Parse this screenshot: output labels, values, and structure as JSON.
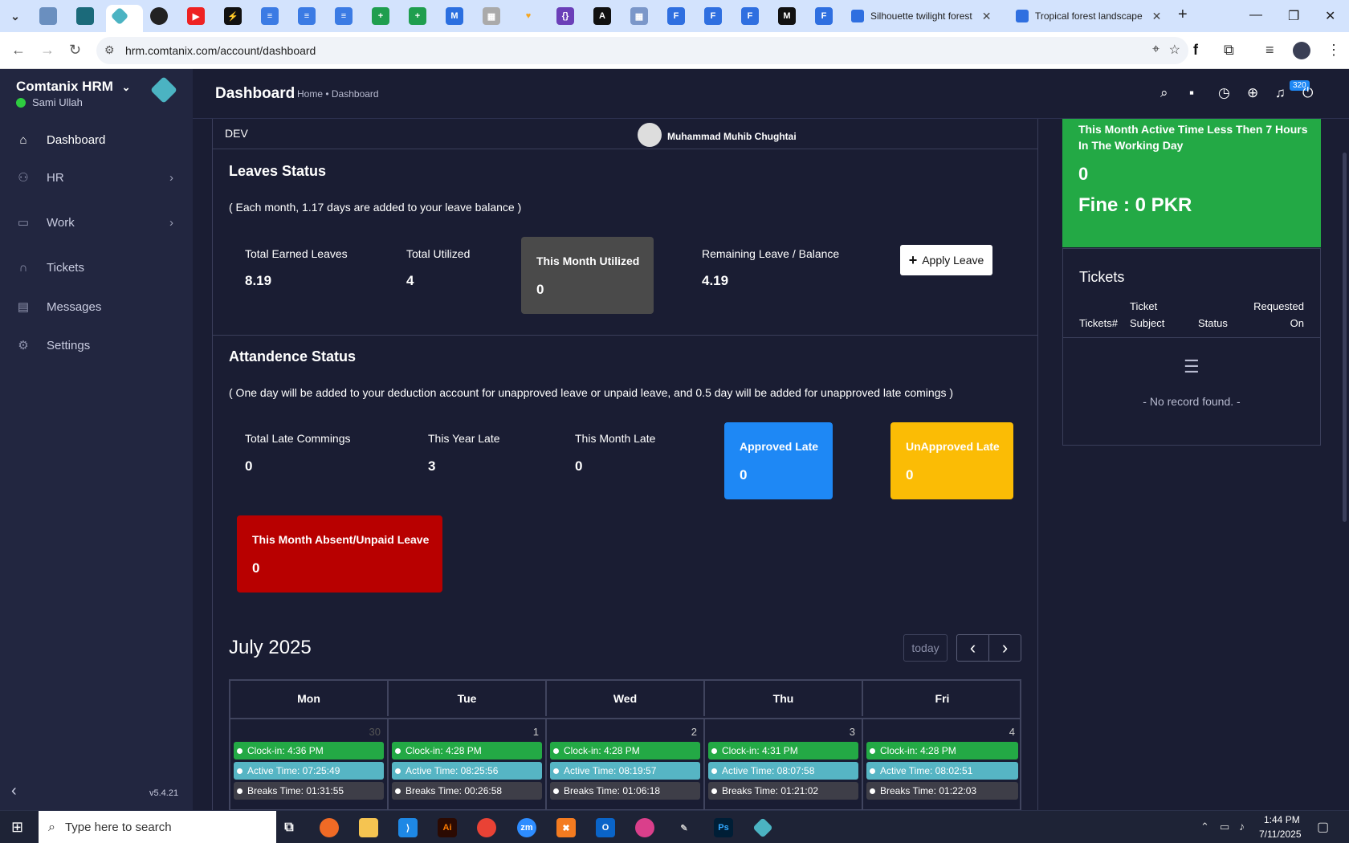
{
  "browser": {
    "tabs": [
      {
        "title": "Silhouette twilight forest",
        "close": "✕"
      },
      {
        "title": "Tropical forest landscape",
        "close": "✕"
      }
    ],
    "new_tab": "+",
    "url": "hrm.comtanix.com/account/dashboard"
  },
  "sidebar": {
    "brand": "Comtanix HRM",
    "user": "Sami Ullah",
    "version": "v5.4.21",
    "items": [
      {
        "label": "Dashboard",
        "icon": "home-icon"
      },
      {
        "label": "HR",
        "icon": "users-icon"
      },
      {
        "label": "Work",
        "icon": "briefcase-icon"
      },
      {
        "label": "Tickets",
        "icon": "headset-icon"
      },
      {
        "label": "Messages",
        "icon": "message-icon"
      },
      {
        "label": "Settings",
        "icon": "gear-icon"
      }
    ]
  },
  "header": {
    "title": "Dashboard",
    "breadcrumb": "Home • Dashboard",
    "notification_count": "320"
  },
  "profile_strip": {
    "dept": "DEV",
    "name": "Muhammad Muhib Chughtai"
  },
  "leaves": {
    "title": "Leaves Status",
    "note": "( Each month, 1.17 days are added to your leave balance )",
    "earned_label": "Total Earned Leaves",
    "earned_value": "8.19",
    "utilized_label": "Total Utilized",
    "utilized_value": "4",
    "month_label": "This Month Utilized",
    "month_value": "0",
    "remaining_label": "Remaining Leave / Balance",
    "remaining_value": "4.19",
    "apply_label": "Apply Leave"
  },
  "attendance": {
    "title": "Attandence Status",
    "note": "( One day will be added to your deduction account for unapproved leave or unpaid leave, and 0.5 day will be added for unapproved late comings )",
    "total_late_label": "Total Late Commings",
    "total_late_value": "0",
    "year_late_label": "This Year Late",
    "year_late_value": "3",
    "month_late_label": "This Month Late",
    "month_late_value": "0",
    "approved_label": "Approved Late",
    "approved_value": "0",
    "unapproved_label": "UnApproved Late",
    "unapproved_value": "0",
    "absent_label": "This Month Absent/Unpaid Leave",
    "absent_value": "0",
    "colors": {
      "approved": "#1e88f5",
      "unapproved": "#fbbc05",
      "absent": "#b80000",
      "month_utilized": "#4a4a4a"
    }
  },
  "calendar": {
    "title": "July 2025",
    "today": "today",
    "prev": "‹",
    "next": "›",
    "days": [
      {
        "name": "Mon",
        "num": "30",
        "clock_in": "Clock-in: 4:36 PM",
        "active": "Active Time: 07:25:49",
        "breaks": "Breaks Time: 01:31:55"
      },
      {
        "name": "Tue",
        "num": "1",
        "clock_in": "Clock-in: 4:28 PM",
        "active": "Active Time: 08:25:56",
        "breaks": "Breaks Time: 00:26:58"
      },
      {
        "name": "Wed",
        "num": "2",
        "clock_in": "Clock-in: 4:28 PM",
        "active": "Active Time: 08:19:57",
        "breaks": "Breaks Time: 01:06:18"
      },
      {
        "name": "Thu",
        "num": "3",
        "clock_in": "Clock-in: 4:31 PM",
        "active": "Active Time: 08:07:58",
        "breaks": "Breaks Time: 01:21:02"
      },
      {
        "name": "Fri",
        "num": "4",
        "clock_in": "Clock-in: 4:28 PM",
        "active": "Active Time: 08:02:51",
        "breaks": "Breaks Time: 01:22:03"
      }
    ]
  },
  "active_time_card": {
    "title": "This Month Active Time Less Then 7 Hours In The Working Day",
    "count": "0",
    "fine": "Fine : 0 PKR",
    "color": "#23a945"
  },
  "tickets": {
    "title": "Tickets",
    "col_ticket_num": "Tickets#",
    "col_subject_1": "Ticket",
    "col_subject_2": "Subject",
    "col_status": "Status",
    "col_requested_1": "Requested",
    "col_requested_2": "On",
    "empty": "- No record found. -"
  },
  "taskbar": {
    "search_placeholder": "Type here to search",
    "time": "1:44 PM",
    "date": "7/11/2025"
  }
}
